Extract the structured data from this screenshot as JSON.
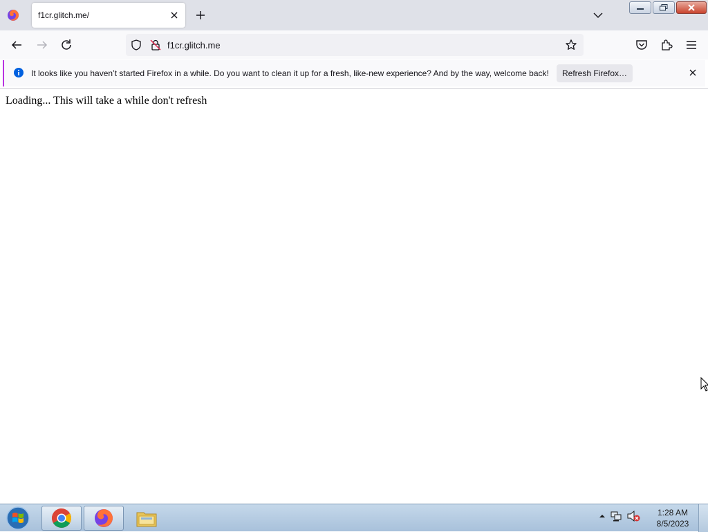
{
  "browser": {
    "tab": {
      "title": "f1cr.glitch.me/"
    },
    "url": "f1cr.glitch.me"
  },
  "notification": {
    "message": "It looks like you haven’t started Firefox in a while. Do you want to clean it up for a fresh, like-new experience? And by the way, welcome back!",
    "button_label": "Refresh Firefox…"
  },
  "page": {
    "text": "Loading... This will take a while don't refresh"
  },
  "taskbar": {
    "apps": [
      "chrome-icon",
      "firefox-icon",
      "file-explorer-icon"
    ],
    "clock": {
      "time": "1:28 AM",
      "date": "8/5/2023"
    }
  },
  "colors": {
    "notification_accent": "#b833e1",
    "info_blue": "#0060df",
    "taskbar": "#a8c1db"
  }
}
